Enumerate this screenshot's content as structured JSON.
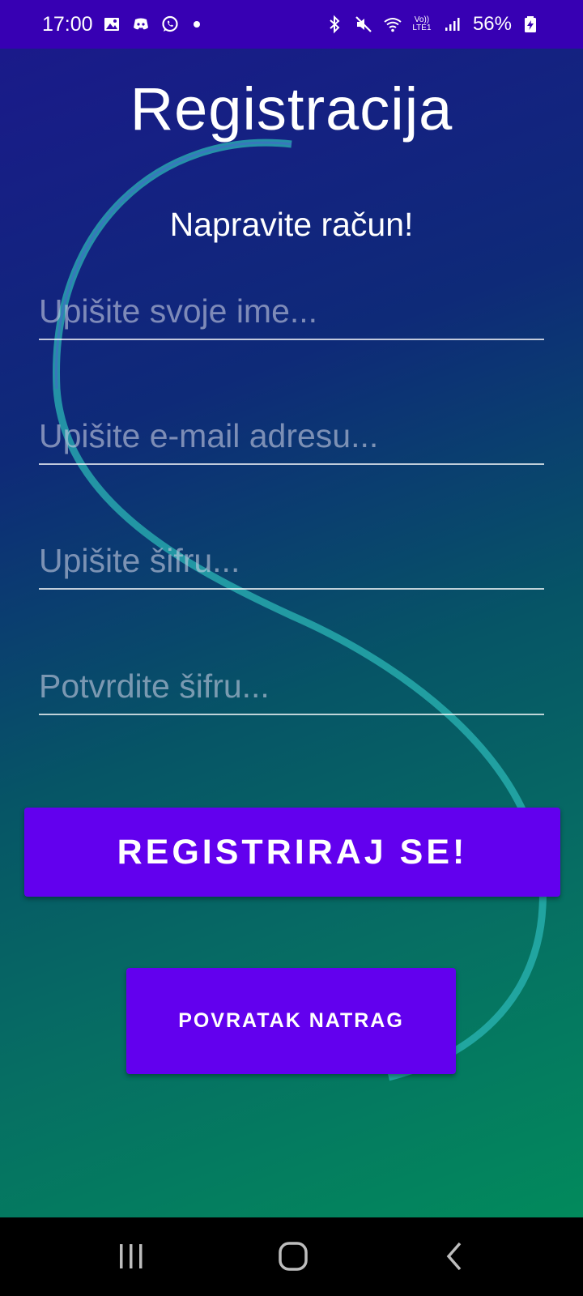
{
  "status_bar": {
    "time": "17:00",
    "battery": "56%",
    "network_label_top": "Vo))",
    "network_label_bottom": "LTE1",
    "icons": [
      "gallery-icon",
      "discord-icon",
      "whatsapp-icon",
      "dot-icon",
      "bluetooth-icon",
      "mute-icon",
      "wifi-icon",
      "volte-icon",
      "signal-icon",
      "battery-icon"
    ]
  },
  "page": {
    "title": "Registracija",
    "subtitle": "Napravite račun!"
  },
  "form": {
    "name_placeholder": "Upišite svoje ime...",
    "email_placeholder": "Upišite e-mail adresu...",
    "password_placeholder": "Upišite šifru...",
    "confirm_placeholder": "Potvrdite šifru...",
    "register_label": "REGISTRIRAJ SE!",
    "back_label": "POVRATAK NATRAG"
  },
  "colors": {
    "status_bar": "#3700b3",
    "button": "#6200ee",
    "gradient_start": "#1a1a8a",
    "gradient_end": "#028a5c",
    "wave": "#2bb5b5"
  },
  "nav_bar": {
    "icons": [
      "recents-icon",
      "home-icon",
      "back-icon"
    ]
  }
}
